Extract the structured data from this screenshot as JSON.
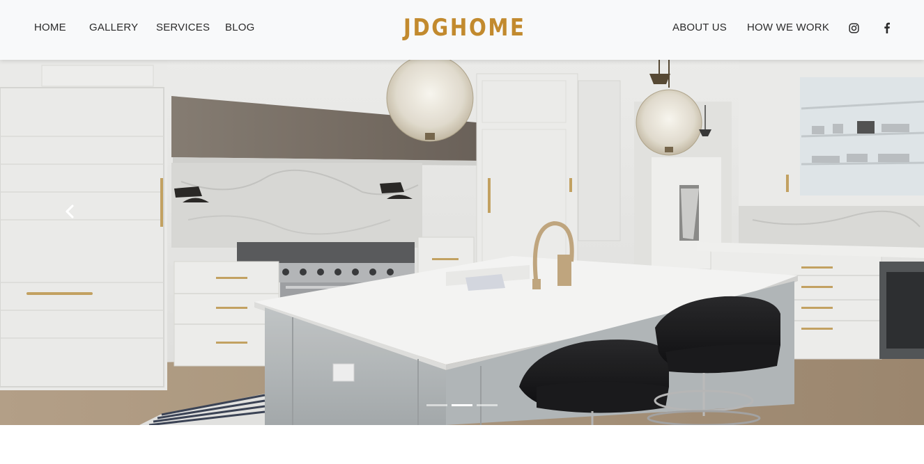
{
  "brand": {
    "name": "JDGHOME",
    "color": "#c28a2e"
  },
  "nav": {
    "left": [
      "HOME",
      "GALLERY",
      "SERVICES",
      "BLOG"
    ],
    "right": [
      "ABOUT US",
      "HOW WE WORK"
    ],
    "social": [
      {
        "icon": "instagram-icon"
      },
      {
        "icon": "facebook-icon"
      }
    ]
  },
  "hero": {
    "image": "white kitchen with island, crystal pendant lights and black bar stools",
    "prev_icon": "chevron-left-icon",
    "slides_total": 3,
    "active_slide": 2
  },
  "colors": {
    "navbar_bg": "#f8f9fa",
    "nav_text": "#2a2a2a",
    "accent": "#c28a2e"
  }
}
